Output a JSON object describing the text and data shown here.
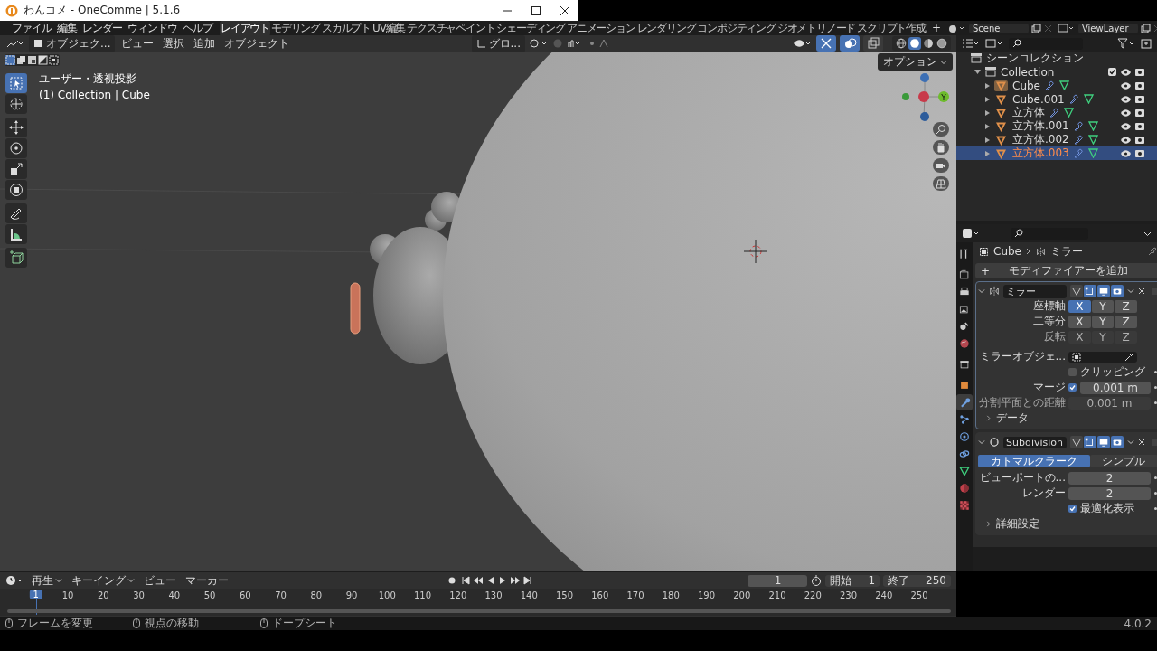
{
  "window": {
    "title": "わんコメ - OneComme | 5.1.6"
  },
  "menu": [
    "ファイル",
    "編集",
    "レンダー",
    "ウィンドウ",
    "ヘルプ"
  ],
  "workspaces": [
    {
      "label": "レイアウト",
      "selected": true
    },
    {
      "label": "モデリング",
      "selected": false
    },
    {
      "label": "スカルプト",
      "selected": false
    },
    {
      "label": "UV編集",
      "selected": false
    },
    {
      "label": "テクスチャペイント",
      "selected": false
    },
    {
      "label": "シェーディング",
      "selected": false
    },
    {
      "label": "アニメーション",
      "selected": false
    },
    {
      "label": "レンダリング",
      "selected": false
    },
    {
      "label": "コンポジティング",
      "selected": false
    },
    {
      "label": "ジオメトリノード",
      "selected": false
    },
    {
      "label": "スクリプト作成",
      "selected": false
    }
  ],
  "add_workspace": "+",
  "scene": "Scene",
  "view_layer": "ViewLayer",
  "viewport": {
    "mode": "オブジェク...",
    "menus": [
      "ビュー",
      "選択",
      "追加",
      "オブジェクト"
    ],
    "orientation": "グロ...",
    "options": "オプション",
    "view_name": "ユーザー・透視投影",
    "context": "(1) Collection | Cube",
    "gizmo_label": "Y",
    "overlays": [
      {
        "kind": "gizmo",
        "on": true
      },
      {
        "kind": "overlay",
        "on": true
      },
      {
        "kind": "xray",
        "on": false
      }
    ],
    "shading": [
      {
        "kind": "wireframe",
        "selected": false
      },
      {
        "kind": "solid",
        "selected": true
      },
      {
        "kind": "material",
        "selected": false
      },
      {
        "kind": "rendered",
        "selected": false
      }
    ],
    "select_modes": [
      {
        "kind": "new",
        "selected": true
      },
      {
        "kind": "extend",
        "selected": false
      },
      {
        "kind": "subtract",
        "selected": false
      },
      {
        "kind": "invert",
        "selected": false
      },
      {
        "kind": "intersect",
        "selected": false
      }
    ],
    "tools": [
      {
        "kind": "select",
        "selected": true
      },
      {
        "kind": "cursor",
        "selected": false
      },
      {
        "kind": "move",
        "selected": false
      },
      {
        "kind": "rotate",
        "selected": false
      },
      {
        "kind": "scale",
        "selected": false
      },
      {
        "kind": "transform",
        "selected": false
      },
      {
        "kind": "annotate",
        "selected": false
      },
      {
        "kind": "measure",
        "selected": false
      },
      {
        "kind": "add-cube",
        "selected": false
      }
    ]
  },
  "outliner": {
    "root": "シーンコレクション",
    "collection": {
      "name": "Collection",
      "expanded": true,
      "checked": true,
      "children": [
        {
          "name": "Cube",
          "active": true,
          "selected": false
        },
        {
          "name": "Cube.001",
          "active": false,
          "selected": false
        },
        {
          "name": "立方体",
          "active": false,
          "selected": false
        },
        {
          "name": "立方体.001",
          "active": false,
          "selected": false
        },
        {
          "name": "立方体.002",
          "active": false,
          "selected": false
        },
        {
          "name": "立方体.003",
          "active": false,
          "selected": true
        }
      ]
    }
  },
  "properties": {
    "tabs": [
      {
        "kind": "tool",
        "selected": false
      },
      {
        "kind": "render",
        "selected": false
      },
      {
        "kind": "output",
        "selected": false
      },
      {
        "kind": "view-layer",
        "selected": false
      },
      {
        "kind": "scene",
        "selected": false
      },
      {
        "kind": "world",
        "selected": false
      },
      {
        "kind": "collection",
        "selected": false
      },
      {
        "kind": "object",
        "selected": false
      },
      {
        "kind": "modifier",
        "selected": true
      },
      {
        "kind": "particles",
        "selected": false
      },
      {
        "kind": "physics",
        "selected": false
      },
      {
        "kind": "constraints",
        "selected": false
      },
      {
        "kind": "data",
        "selected": false
      },
      {
        "kind": "material",
        "selected": false
      },
      {
        "kind": "texture",
        "selected": false
      }
    ],
    "breadcrumb": [
      "Cube",
      "ミラー"
    ],
    "add_modifier_icon": "+",
    "add_modifier": "モディファイアーを追加",
    "modifiers": [
      {
        "kind": "mirror",
        "name": "ミラー",
        "expanded": true,
        "toggles": [
          {
            "kind": "on-cage",
            "on": false
          },
          {
            "kind": "edit-mode",
            "on": true
          },
          {
            "kind": "viewport",
            "on": true
          },
          {
            "kind": "render",
            "on": true
          }
        ],
        "rows": [
          {
            "kind": "axes",
            "label": "座標軸",
            "disabled": false,
            "buttons": [
              {
                "label": "X",
                "selected": true
              },
              {
                "label": "Y",
                "selected": false
              },
              {
                "label": "Z",
                "selected": false
              }
            ]
          },
          {
            "kind": "axes",
            "label": "二等分",
            "disabled": false,
            "buttons": [
              {
                "label": "X",
                "selected": false
              },
              {
                "label": "Y",
                "selected": false
              },
              {
                "label": "Z",
                "selected": false
              }
            ]
          },
          {
            "kind": "axes",
            "label": "反転",
            "disabled": true,
            "buttons": [
              {
                "label": "X",
                "selected": false
              },
              {
                "label": "Y",
                "selected": false
              },
              {
                "label": "Z",
                "selected": false
              }
            ]
          },
          {
            "kind": "object",
            "label": "ミラーオブジェ..."
          },
          {
            "kind": "check",
            "label": "クリッピング",
            "checked": false
          },
          {
            "kind": "check-number",
            "label": "マージ",
            "checked": true,
            "value": "0.001 m",
            "disabled": false
          },
          {
            "kind": "number",
            "label": "分割平面との距離",
            "value": "0.001 m",
            "disabled": true
          },
          {
            "kind": "subpanel",
            "label": "データ",
            "expanded": false
          }
        ]
      },
      {
        "kind": "subdivision",
        "name": "Subdivision",
        "expanded": true,
        "toggles": [
          {
            "kind": "on-cage",
            "on": false
          },
          {
            "kind": "edit-mode",
            "on": true
          },
          {
            "kind": "viewport",
            "on": true
          },
          {
            "kind": "render",
            "on": true
          }
        ],
        "rows": [
          {
            "kind": "tabs",
            "buttons": [
              {
                "label": "カトマルクラーク",
                "selected": true
              },
              {
                "label": "シンプル",
                "selected": false
              }
            ]
          },
          {
            "kind": "number",
            "label": "ビューポートの...",
            "value": "2",
            "disabled": false
          },
          {
            "kind": "number",
            "label": "レンダー",
            "value": "2",
            "disabled": false
          },
          {
            "kind": "check-only",
            "label": "最適化表示",
            "checked": true
          },
          {
            "kind": "subpanel",
            "label": "詳細設定",
            "expanded": false
          }
        ]
      }
    ]
  },
  "timeline": {
    "menus": [
      "再生",
      "キーイング",
      "ビュー",
      "マーカー"
    ],
    "current_frame": "1",
    "start_label": "開始",
    "start": "1",
    "end_label": "終了",
    "end": "250",
    "playhead": "1",
    "ticks": [
      "10",
      "20",
      "30",
      "40",
      "50",
      "60",
      "70",
      "80",
      "90",
      "100",
      "110",
      "120",
      "130",
      "140",
      "150",
      "160",
      "170",
      "180",
      "190",
      "200",
      "210",
      "220",
      "230",
      "240",
      "250"
    ]
  },
  "status_bar": {
    "hints": [
      "フレームを変更",
      "視点の移動",
      "ドープシート"
    ],
    "version": "4.0.2"
  }
}
